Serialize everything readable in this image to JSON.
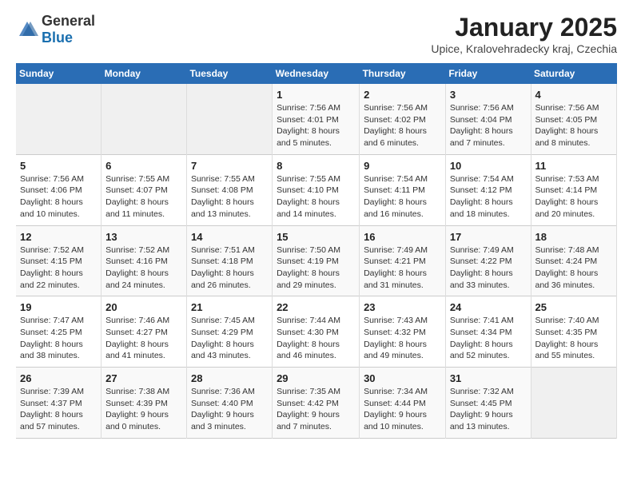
{
  "header": {
    "logo_general": "General",
    "logo_blue": "Blue",
    "title": "January 2025",
    "subtitle": "Upice, Kralovehradecky kraj, Czechia"
  },
  "calendar": {
    "weekdays": [
      "Sunday",
      "Monday",
      "Tuesday",
      "Wednesday",
      "Thursday",
      "Friday",
      "Saturday"
    ],
    "weeks": [
      [
        {
          "day": "",
          "info": ""
        },
        {
          "day": "",
          "info": ""
        },
        {
          "day": "",
          "info": ""
        },
        {
          "day": "1",
          "info": "Sunrise: 7:56 AM\nSunset: 4:01 PM\nDaylight: 8 hours and 5 minutes."
        },
        {
          "day": "2",
          "info": "Sunrise: 7:56 AM\nSunset: 4:02 PM\nDaylight: 8 hours and 6 minutes."
        },
        {
          "day": "3",
          "info": "Sunrise: 7:56 AM\nSunset: 4:04 PM\nDaylight: 8 hours and 7 minutes."
        },
        {
          "day": "4",
          "info": "Sunrise: 7:56 AM\nSunset: 4:05 PM\nDaylight: 8 hours and 8 minutes."
        }
      ],
      [
        {
          "day": "5",
          "info": "Sunrise: 7:56 AM\nSunset: 4:06 PM\nDaylight: 8 hours and 10 minutes."
        },
        {
          "day": "6",
          "info": "Sunrise: 7:55 AM\nSunset: 4:07 PM\nDaylight: 8 hours and 11 minutes."
        },
        {
          "day": "7",
          "info": "Sunrise: 7:55 AM\nSunset: 4:08 PM\nDaylight: 8 hours and 13 minutes."
        },
        {
          "day": "8",
          "info": "Sunrise: 7:55 AM\nSunset: 4:10 PM\nDaylight: 8 hours and 14 minutes."
        },
        {
          "day": "9",
          "info": "Sunrise: 7:54 AM\nSunset: 4:11 PM\nDaylight: 8 hours and 16 minutes."
        },
        {
          "day": "10",
          "info": "Sunrise: 7:54 AM\nSunset: 4:12 PM\nDaylight: 8 hours and 18 minutes."
        },
        {
          "day": "11",
          "info": "Sunrise: 7:53 AM\nSunset: 4:14 PM\nDaylight: 8 hours and 20 minutes."
        }
      ],
      [
        {
          "day": "12",
          "info": "Sunrise: 7:52 AM\nSunset: 4:15 PM\nDaylight: 8 hours and 22 minutes."
        },
        {
          "day": "13",
          "info": "Sunrise: 7:52 AM\nSunset: 4:16 PM\nDaylight: 8 hours and 24 minutes."
        },
        {
          "day": "14",
          "info": "Sunrise: 7:51 AM\nSunset: 4:18 PM\nDaylight: 8 hours and 26 minutes."
        },
        {
          "day": "15",
          "info": "Sunrise: 7:50 AM\nSunset: 4:19 PM\nDaylight: 8 hours and 29 minutes."
        },
        {
          "day": "16",
          "info": "Sunrise: 7:49 AM\nSunset: 4:21 PM\nDaylight: 8 hours and 31 minutes."
        },
        {
          "day": "17",
          "info": "Sunrise: 7:49 AM\nSunset: 4:22 PM\nDaylight: 8 hours and 33 minutes."
        },
        {
          "day": "18",
          "info": "Sunrise: 7:48 AM\nSunset: 4:24 PM\nDaylight: 8 hours and 36 minutes."
        }
      ],
      [
        {
          "day": "19",
          "info": "Sunrise: 7:47 AM\nSunset: 4:25 PM\nDaylight: 8 hours and 38 minutes."
        },
        {
          "day": "20",
          "info": "Sunrise: 7:46 AM\nSunset: 4:27 PM\nDaylight: 8 hours and 41 minutes."
        },
        {
          "day": "21",
          "info": "Sunrise: 7:45 AM\nSunset: 4:29 PM\nDaylight: 8 hours and 43 minutes."
        },
        {
          "day": "22",
          "info": "Sunrise: 7:44 AM\nSunset: 4:30 PM\nDaylight: 8 hours and 46 minutes."
        },
        {
          "day": "23",
          "info": "Sunrise: 7:43 AM\nSunset: 4:32 PM\nDaylight: 8 hours and 49 minutes."
        },
        {
          "day": "24",
          "info": "Sunrise: 7:41 AM\nSunset: 4:34 PM\nDaylight: 8 hours and 52 minutes."
        },
        {
          "day": "25",
          "info": "Sunrise: 7:40 AM\nSunset: 4:35 PM\nDaylight: 8 hours and 55 minutes."
        }
      ],
      [
        {
          "day": "26",
          "info": "Sunrise: 7:39 AM\nSunset: 4:37 PM\nDaylight: 8 hours and 57 minutes."
        },
        {
          "day": "27",
          "info": "Sunrise: 7:38 AM\nSunset: 4:39 PM\nDaylight: 9 hours and 0 minutes."
        },
        {
          "day": "28",
          "info": "Sunrise: 7:36 AM\nSunset: 4:40 PM\nDaylight: 9 hours and 3 minutes."
        },
        {
          "day": "29",
          "info": "Sunrise: 7:35 AM\nSunset: 4:42 PM\nDaylight: 9 hours and 7 minutes."
        },
        {
          "day": "30",
          "info": "Sunrise: 7:34 AM\nSunset: 4:44 PM\nDaylight: 9 hours and 10 minutes."
        },
        {
          "day": "31",
          "info": "Sunrise: 7:32 AM\nSunset: 4:45 PM\nDaylight: 9 hours and 13 minutes."
        },
        {
          "day": "",
          "info": ""
        }
      ]
    ]
  }
}
